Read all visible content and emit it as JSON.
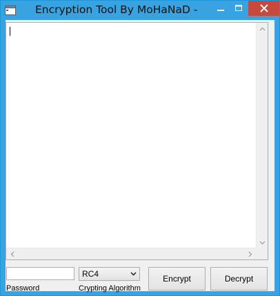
{
  "window": {
    "title": "Encryption Tool By MoHaNaD -",
    "accent_color": "#39a3e2",
    "close_color": "#c7483d"
  },
  "main_text": {
    "value": ""
  },
  "password": {
    "value": "",
    "label": "Password"
  },
  "algorithm": {
    "selected": "RC4",
    "label": "Crypting Algorithm"
  },
  "buttons": {
    "encrypt": "Encrypt",
    "decrypt": "Decrypt"
  }
}
